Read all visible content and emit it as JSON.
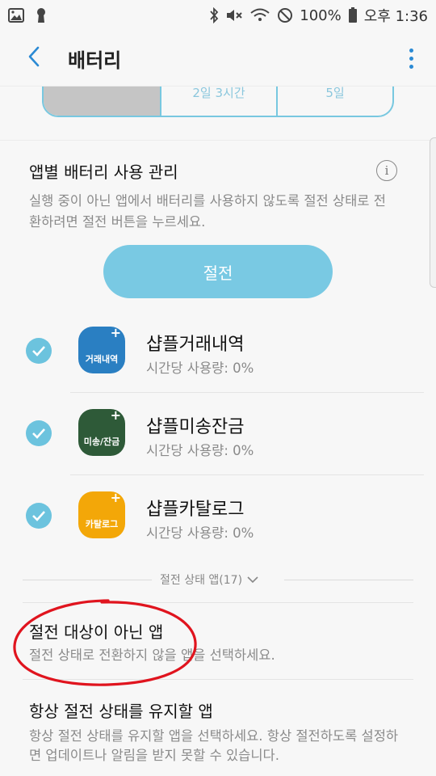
{
  "status_bar": {
    "battery_percent": "100%",
    "time": "오후 1:36",
    "icons": [
      "image-icon",
      "keyhole-icon",
      "bluetooth-icon",
      "mute-icon",
      "wifi-icon",
      "do-not-disturb-icon",
      "battery-icon"
    ]
  },
  "app_bar": {
    "title": "배터리",
    "back_icon": "chevron-left-icon",
    "more_icon": "more-vert-icon"
  },
  "segments": [
    "",
    "2일 3시간",
    "5일"
  ],
  "manage": {
    "title": "앱별 배터리 사용 관리",
    "description": "실행 중이 아닌 앱에서 배터리를 사용하지 않도록 절전 상태로 전환하려면 절전 버튼을 누르세요.",
    "button_label": "절전"
  },
  "apps": [
    {
      "name": "샵플거래내역",
      "usage": "시간당 사용량: 0%",
      "icon_label": "거래내역",
      "icon_color": "#2a7fc2",
      "checked": true
    },
    {
      "name": "샵플미송잔금",
      "usage": "시간당 사용량: 0%",
      "icon_label": "미송/잔금",
      "icon_color": "#2e5a38",
      "checked": true
    },
    {
      "name": "샵플카탈로그",
      "usage": "시간당 사용량: 0%",
      "icon_label": "카탈로그",
      "icon_color": "#f3a708",
      "checked": true
    }
  ],
  "expander_label": "절전 상태 앱(17)",
  "non_target": {
    "title": "절전 대상이 아닌 앱",
    "subtitle": "절전 상태로 전환하지 않을 앱을 선택하세요."
  },
  "always_save": {
    "title": "항상 절전 상태를 유지할 앱",
    "subtitle": "항상 절전 상태를 유지할 앱을 선택하세요. 항상 절전하도록 설정하면 업데이트나 알림을 받지 못할 수 있습니다."
  },
  "colors": {
    "accent": "#79c9e3",
    "check": "#6cc3de",
    "annotation": "#e0141e",
    "link_blue": "#2b8ad4"
  }
}
